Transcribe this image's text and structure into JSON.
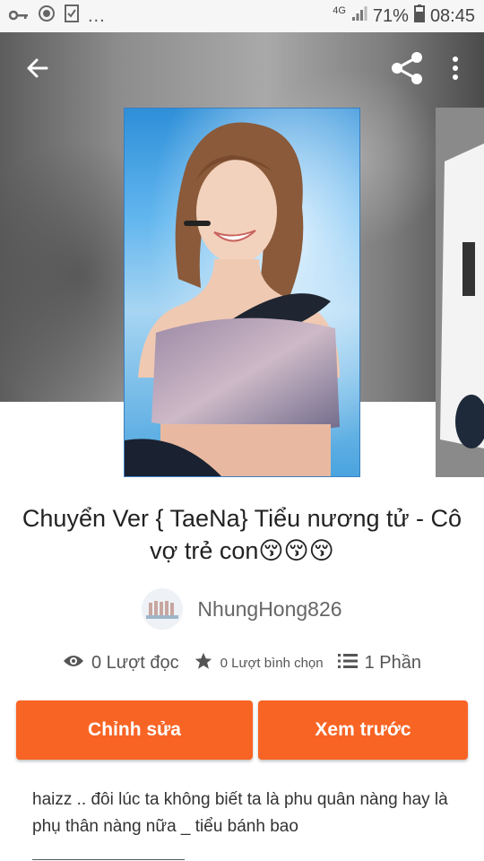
{
  "status_bar": {
    "network": "4G",
    "battery": "71%",
    "time": "08:45",
    "more": "..."
  },
  "toolbar": {
    "back_icon": "arrow-left-icon",
    "share_icon": "share-icon",
    "more_icon": "more-vertical-icon"
  },
  "story": {
    "title": "Chuyển Ver  { TaeNa}  Tiểu nương tử - Cô vợ trẻ con😚😚😚",
    "author": "NhungHong826",
    "description": "haizz .. đôi lúc ta không biết ta là phu quân nàng hay là phụ thân nàng nữa _ tiểu bánh bao"
  },
  "stats": {
    "reads": "0 Lượt đọc",
    "votes": "0 Lượt bình chọn",
    "parts": "1 Phần"
  },
  "actions": {
    "edit_label": "Chỉnh sửa",
    "preview_label": "Xem trước"
  },
  "colors": {
    "accent": "#f86424",
    "text": "#222222",
    "muted": "#666666"
  }
}
